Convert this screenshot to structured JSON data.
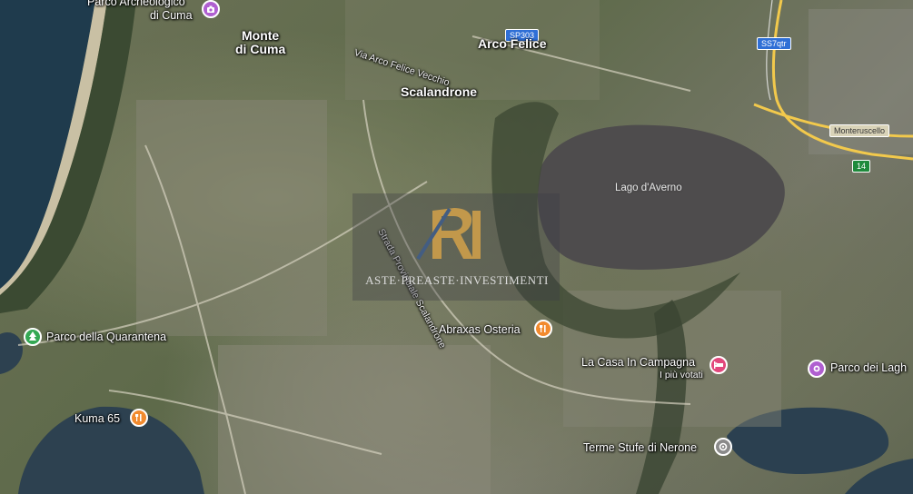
{
  "map": {
    "places": [
      {
        "key": "parco_archeologico",
        "text": "Parco Archeologico"
      },
      {
        "key": "di_cuma",
        "text": "di Cuma"
      },
      {
        "key": "monte",
        "text": "Monte"
      },
      {
        "key": "di_cuma2",
        "text": "di Cuma"
      },
      {
        "key": "arco_felice",
        "text": "Arco Felice"
      },
      {
        "key": "scalandrone",
        "text": "Scalandrone"
      },
      {
        "key": "lago_averno",
        "text": "Lago d'Averno"
      },
      {
        "key": "monteruscello",
        "text": "Monteruscello"
      },
      {
        "key": "parco_quarantena",
        "text": "Parco della Quarantena"
      },
      {
        "key": "abraxas",
        "text": "Abraxas Osteria"
      },
      {
        "key": "casa_campagna",
        "text": "La Casa In Campagna"
      },
      {
        "key": "piu_votati",
        "text": "I più votati"
      },
      {
        "key": "parco_laghi",
        "text": "Parco dei Lagh"
      },
      {
        "key": "kuma65",
        "text": "Kuma 65"
      },
      {
        "key": "terme",
        "text": "Terme Stufe di Nerone"
      },
      {
        "key": "via_arco_felice",
        "text": "Via Arco Felice Vecchio"
      },
      {
        "key": "strada_scalandrone",
        "text": "Strada Provinciale Scalandrone"
      }
    ],
    "road_shields": {
      "sp303": "SP303",
      "ss7qtr": "SS7qtr",
      "r14": "14"
    },
    "colors": {
      "sea": "#1f3b4d",
      "lake": "#4e4c4d",
      "pin_restaurant": "#f28a2e",
      "pin_park": "#34a853",
      "pin_attraction": "#b05fd0",
      "pin_hotel": "#e2477c",
      "pin_spa": "#8a8a8a"
    }
  },
  "watermark": {
    "brand": "Aste Preaste Investimenti",
    "caption": "ASTE·PREASTE·INVESTIMENTI",
    "monogram": "RI"
  }
}
